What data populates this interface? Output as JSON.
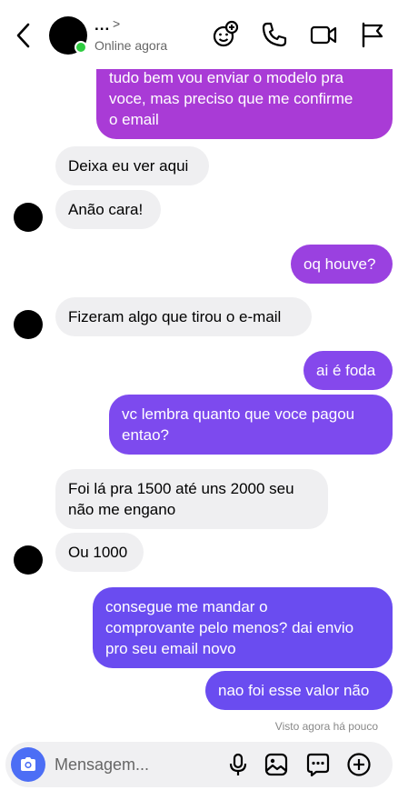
{
  "header": {
    "name": "...",
    "chevron": ">",
    "status": "Online agora",
    "icons": [
      "back-chevron-icon",
      "sticker-add-icon",
      "phone-icon",
      "video-camera-icon",
      "flag-icon"
    ]
  },
  "messages": [
    {
      "side": "out",
      "text": "tudo bem vou enviar o modelo pra\nvoce, mas preciso que me confirme\no email"
    },
    {
      "side": "in",
      "text": "Deixa eu ver aqui"
    },
    {
      "side": "in",
      "text": "Anão cara!"
    },
    {
      "side": "out",
      "text": "oq houve?"
    },
    {
      "side": "in",
      "text": "Fizeram algo que tirou o e-mail"
    },
    {
      "side": "out",
      "text": "ai é foda"
    },
    {
      "side": "out",
      "text": "vc lembra quanto que voce pagou\nentao?"
    },
    {
      "side": "in",
      "text": "Foi lá pra 1500 até uns 2000 seu\nnão me engano"
    },
    {
      "side": "in",
      "text": "Ou 1000"
    },
    {
      "side": "out",
      "text": "consegue me mandar o\ncomprovante pelo menos? dai envio\npro seu email novo"
    },
    {
      "side": "out",
      "text": "nao foi esse valor não"
    }
  ],
  "seen_text": "Visto agora há pouco",
  "composer": {
    "placeholder": "Mensagem...",
    "icons": [
      "camera-icon",
      "microphone-icon",
      "image-icon",
      "sticker-chat-icon",
      "plus-icon"
    ]
  },
  "colors": {
    "online": "#2ecc40",
    "bubble_in": "#efeff1",
    "bubble_out_top": "#a93bd6",
    "bubble_out_bottom": "#6a4cf0",
    "camera_button": "#4c6ef5"
  }
}
